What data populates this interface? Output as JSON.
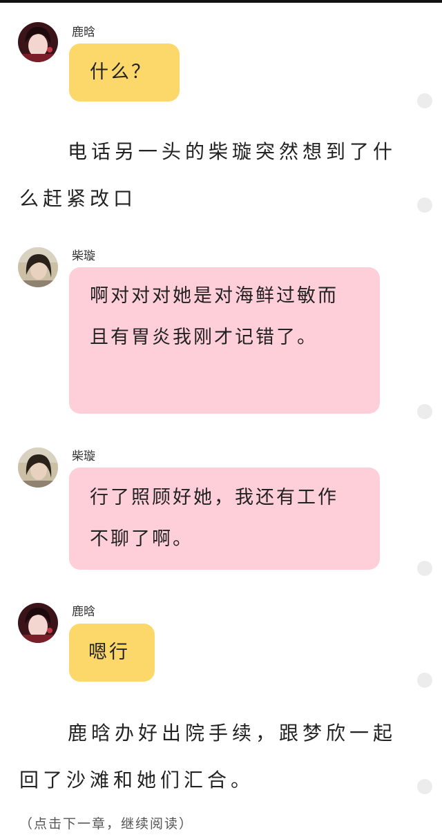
{
  "messages": [
    {
      "sender": "鹿晗",
      "text": "什么？"
    },
    {
      "sender": "柴璇",
      "text": "啊对对对她是对海鲜过敏而且有胃炎我刚才记错了。"
    },
    {
      "sender": "柴璇",
      "text": "行了照顾好她，我还有工作不聊了啊。"
    },
    {
      "sender": "鹿晗",
      "text": "嗯行"
    }
  ],
  "narrations": [
    {
      "line1": "电话另一头的柴璇突然想到了什",
      "line2": "么赶紧改口"
    },
    {
      "line1": "鹿晗办好出院手续，跟梦欣一起",
      "line2": "回了沙滩和她们汇合。"
    }
  ],
  "footer": {
    "text": "（点击下一章，继续阅读）"
  },
  "colors": {
    "bubble_luhan": "#fcd76a",
    "bubble_chaixuan": "#ffcfd9",
    "background": "#ffffff"
  }
}
